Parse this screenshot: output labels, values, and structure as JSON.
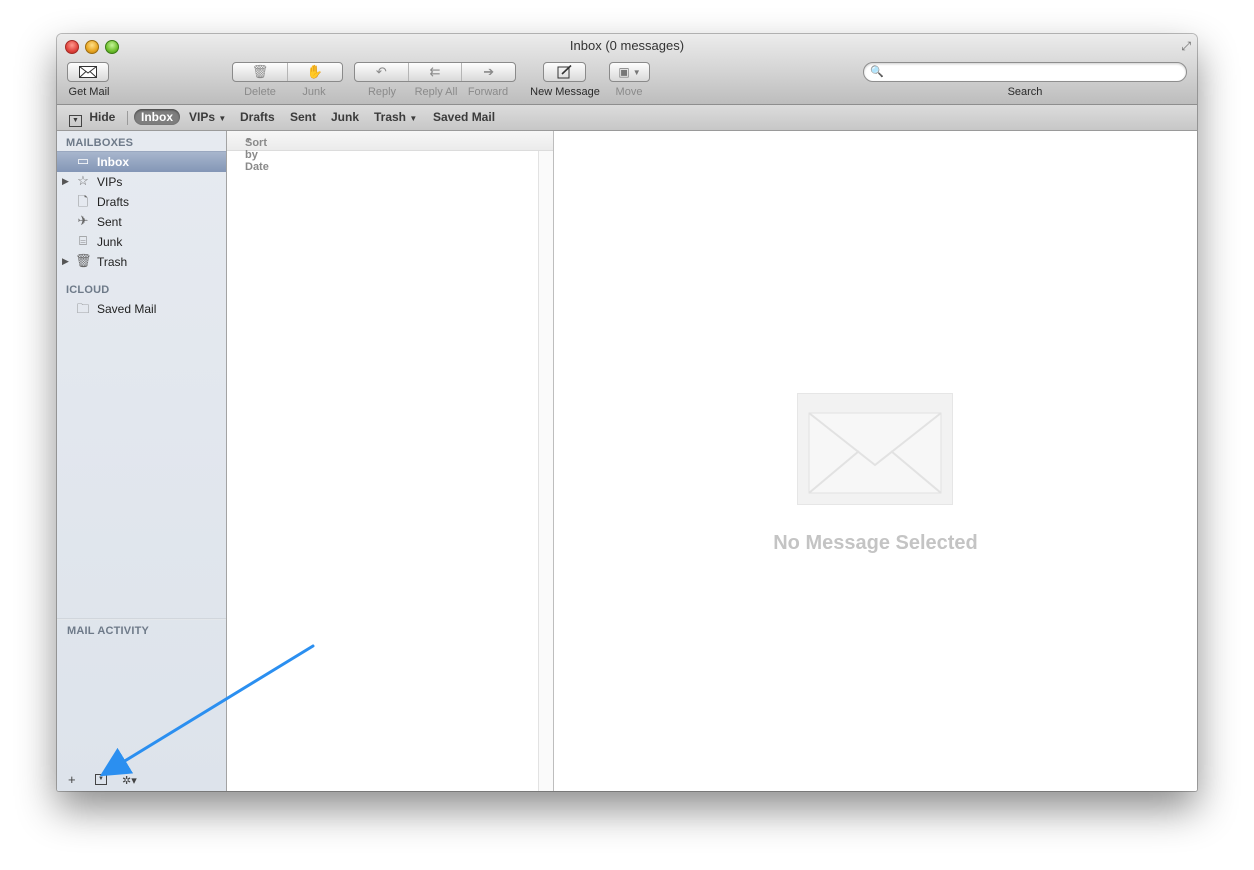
{
  "window": {
    "title": "Inbox (0 messages)"
  },
  "toolbar": {
    "get_mail": "Get Mail",
    "delete": "Delete",
    "junk": "Junk",
    "reply": "Reply",
    "reply_all": "Reply All",
    "forward": "Forward",
    "new_message": "New Message",
    "move": "Move",
    "search_label": "Search",
    "search_value": ""
  },
  "favorites": {
    "hide": "Hide",
    "items": [
      "Inbox",
      "VIPs",
      "Drafts",
      "Sent",
      "Junk",
      "Trash",
      "Saved Mail"
    ],
    "active": "Inbox"
  },
  "sidebar": {
    "mailboxes_header": "MAILBOXES",
    "mailboxes": [
      {
        "label": "Inbox",
        "icon": "inbox-icon",
        "selected": true
      },
      {
        "label": "VIPs",
        "icon": "star-icon",
        "expandable": true
      },
      {
        "label": "Drafts",
        "icon": "document-icon"
      },
      {
        "label": "Sent",
        "icon": "paper-plane-icon"
      },
      {
        "label": "Junk",
        "icon": "junk-bin-icon"
      },
      {
        "label": "Trash",
        "icon": "trash-icon",
        "expandable": true
      }
    ],
    "icloud_header": "ICLOUD",
    "icloud": [
      {
        "label": "Saved Mail",
        "icon": "folder-icon"
      }
    ],
    "activity_header": "MAIL ACTIVITY",
    "bottom": {
      "add": "+",
      "gear": "✲▾"
    }
  },
  "message_list": {
    "sort_label": "Sort by Date"
  },
  "viewer": {
    "empty_text": "No Message Selected"
  },
  "colors": {
    "selection": "#8396b6",
    "annotation_arrow": "#2b8ff0"
  }
}
